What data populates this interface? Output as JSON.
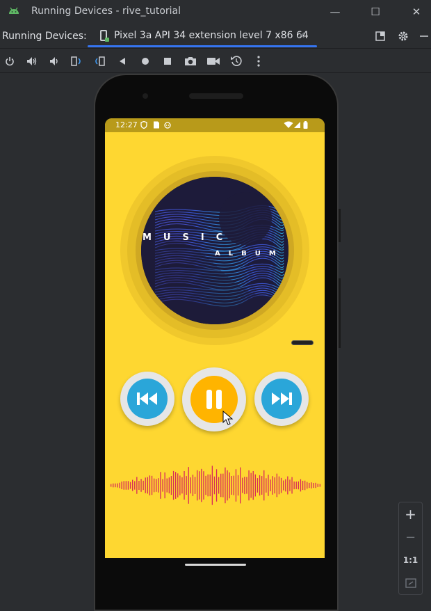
{
  "window": {
    "title": "Running Devices - rive_tutorial",
    "minimize_glyph": "—",
    "maximize_glyph": "☐",
    "close_glyph": "✕"
  },
  "tool_header": {
    "label": "Running Devices:",
    "device_tab": {
      "name": "Pixel 3a API 34 extension level 7 x86 64",
      "close_glyph": "×"
    },
    "icons": [
      "layout-icon",
      "gear-icon",
      "minimize-icon"
    ]
  },
  "toolbar": {
    "buttons": [
      "power-icon",
      "volume-up-icon",
      "volume-down-icon",
      "rotate-left-icon",
      "rotate-right-icon",
      "back-icon",
      "home-icon",
      "overview-icon",
      "camera-icon",
      "record-icon",
      "reset-icon",
      "more-icon"
    ]
  },
  "device_screen": {
    "status_bar": {
      "time": "12:27"
    },
    "album": {
      "title_line1": "MUSIC",
      "title_line2": "ALBUM"
    },
    "controls": {
      "previous": "previous-track-icon",
      "play_pause": "pause-icon",
      "next": "next-track-icon"
    },
    "colors": {
      "background": "#fed731",
      "disc": "#1d1b3a",
      "skip_button": "#2aa6d9",
      "pause_button": "#ffb400",
      "waveform": "#d8285a"
    }
  },
  "zoom": {
    "zoom_in": "+",
    "zoom_out": "−",
    "actual_size": "1:1"
  }
}
